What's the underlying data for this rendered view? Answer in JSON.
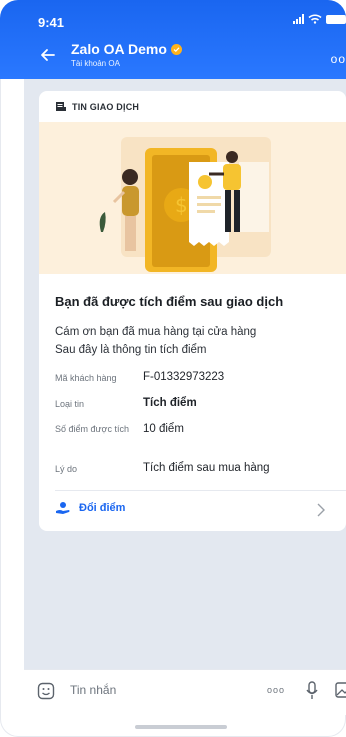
{
  "status": {
    "time": "9:41"
  },
  "header": {
    "title": "Zalo OA Demo",
    "subtitle": "Tài khoản OA"
  },
  "card": {
    "section_label": "TIN GIAO DỊCH",
    "title": "Bạn đã được tích điểm sau giao dịch",
    "desc_line1": "Cám ơn bạn đã mua hàng tại cửa hàng",
    "desc_line2": "Sau đây là thông tin tích điểm",
    "rows": [
      {
        "label": "Mã khách hàng",
        "value": "F-01332973223"
      },
      {
        "label": "Loại tin",
        "value": "Tích điểm"
      },
      {
        "label": "Số điểm được tích",
        "value": "10 điểm"
      },
      {
        "label": "Lý do",
        "value": "Tích điểm sau mua hàng"
      }
    ],
    "action_label": "Đổi điểm"
  },
  "input": {
    "placeholder": "Tin nhắn"
  },
  "colors": {
    "brand": "#1a66f0",
    "accent_yellow": "#f6c431",
    "illustration_bg": "#fdf0dc",
    "chat_bg": "#e3e8f0"
  }
}
